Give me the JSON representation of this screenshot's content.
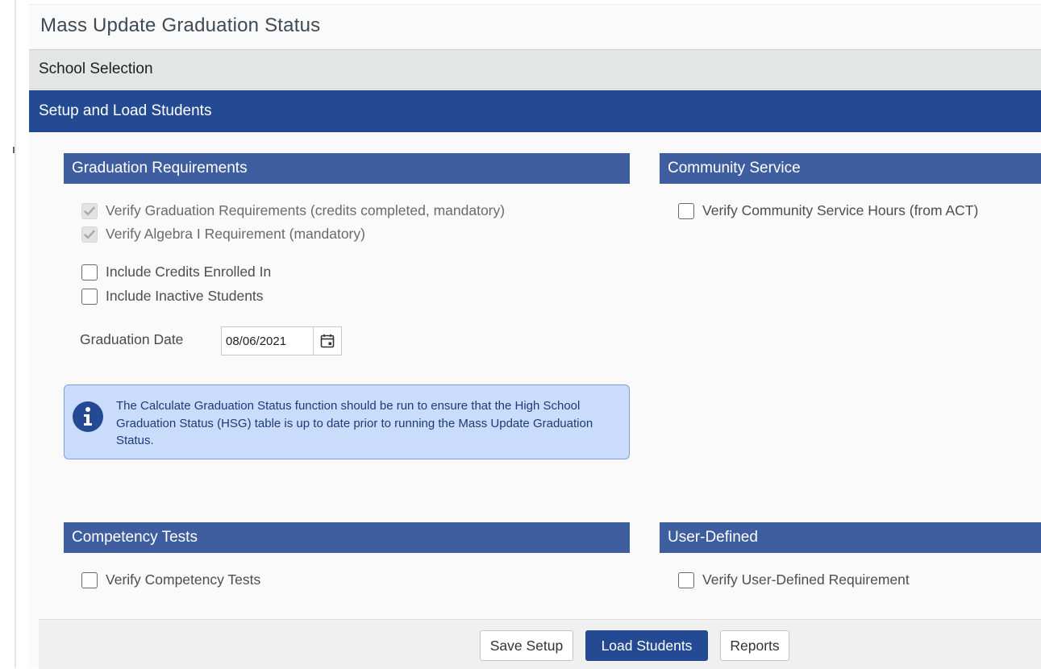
{
  "page": {
    "title": "Mass Update Graduation Status"
  },
  "accordion": {
    "school_selection": "School Selection",
    "setup_load": "Setup and Load Students"
  },
  "graduation_requirements": {
    "header": "Graduation Requirements",
    "verify_grad_req": {
      "label": "Verify Graduation Requirements (credits completed, mandatory)",
      "checked": true,
      "disabled": true
    },
    "verify_algebra": {
      "label": "Verify Algebra I Requirement (mandatory)",
      "checked": true,
      "disabled": true
    },
    "include_credits_enrolled": {
      "label": "Include Credits Enrolled In",
      "checked": false
    },
    "include_inactive": {
      "label": "Include Inactive Students",
      "checked": false
    },
    "graduation_date_label": "Graduation Date",
    "graduation_date_value": "08/06/2021",
    "info_message": "The Calculate Graduation Status function should be run to ensure that the High School Graduation Status (HSG) table is up to date prior to running the Mass Update Graduation Status."
  },
  "community_service": {
    "header": "Community Service",
    "verify_hours": {
      "label": "Verify Community Service Hours (from ACT)",
      "checked": false
    }
  },
  "competency_tests": {
    "header": "Competency Tests",
    "verify_tests": {
      "label": "Verify Competency Tests",
      "checked": false
    }
  },
  "user_defined": {
    "header": "User-Defined",
    "verify_requirement": {
      "label": "Verify User-Defined Requirement",
      "checked": false
    }
  },
  "footer": {
    "save_setup": "Save Setup",
    "load_students": "Load Students",
    "reports": "Reports"
  },
  "colors": {
    "primary": "#254a94",
    "section_header": "#3f5e9f",
    "info_bg": "#cadcfb",
    "info_border": "#7d9cd8"
  }
}
